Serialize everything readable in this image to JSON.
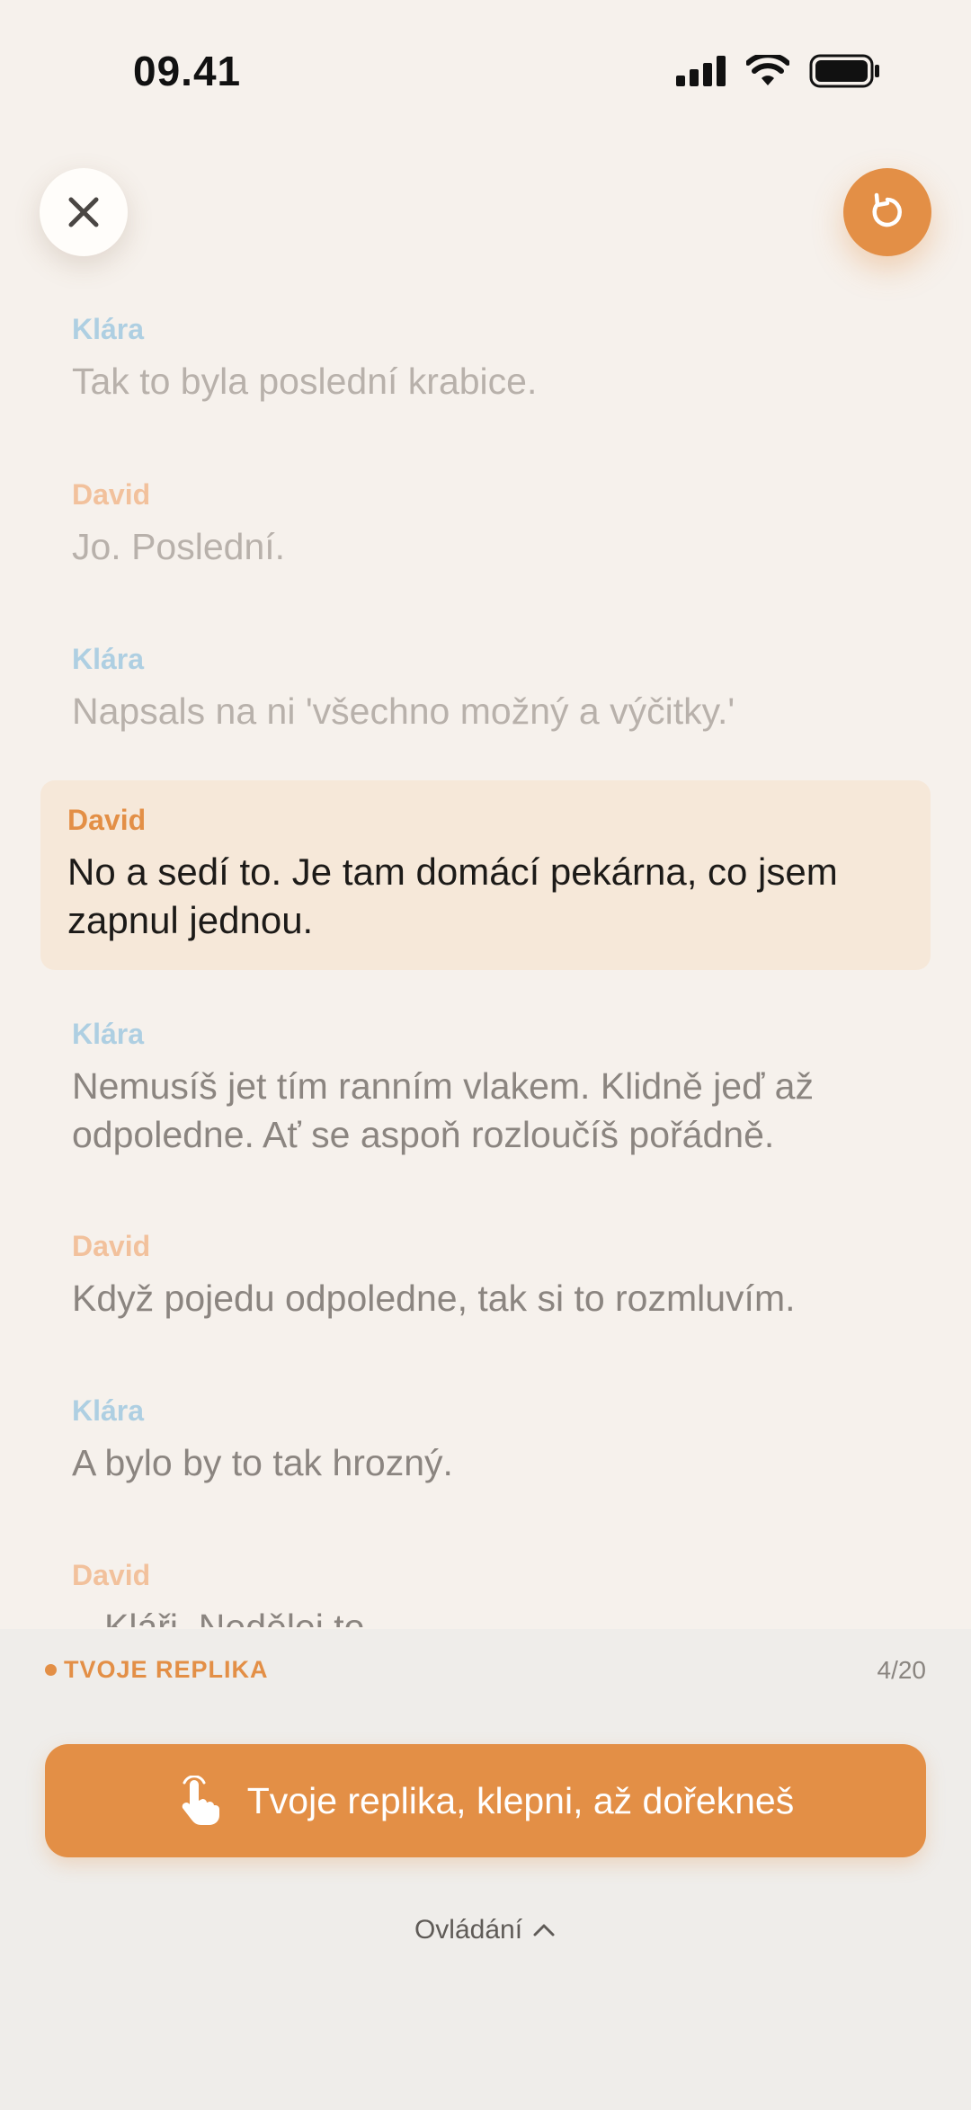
{
  "status_bar": {
    "time": "09.41"
  },
  "top_bar": {
    "close_icon": "close-icon",
    "restart_icon": "restart-icon"
  },
  "script": [
    {
      "speaker": "Klára",
      "text": "Tak to byla poslední krabice."
    },
    {
      "speaker": "David",
      "text": "Jo. Poslední."
    },
    {
      "speaker": "Klára",
      "text": "Napsals na ni 'všechno možný a výčitky.'"
    },
    {
      "speaker": "David",
      "text": "No a sedí to. Je tam domácí pekárna, co jsem zapnul jednou."
    },
    {
      "speaker": "Klára",
      "text": "Nemusíš jet tím ranním vlakem. Klidně jeď až odpoledne. Ať se aspoň rozloučíš pořádně."
    },
    {
      "speaker": "David",
      "text": "Když pojedu odpoledne, tak si to rozmluvím."
    },
    {
      "speaker": "Klára",
      "text": "A bylo by to tak hrozný."
    },
    {
      "speaker": "David",
      "text": "Kláři. Nedělej to."
    }
  ],
  "bottom": {
    "replika_label": "TVOJE REPLIKA",
    "counter": "4/20",
    "button_label": "Tvoje replika, klepni, až dořekneš",
    "controls_label": "Ovládání"
  },
  "colors": {
    "accent": "#e38f46",
    "klara": "#aecfe2",
    "david": "#f2c19c",
    "highlight": "#f6e8d9"
  }
}
